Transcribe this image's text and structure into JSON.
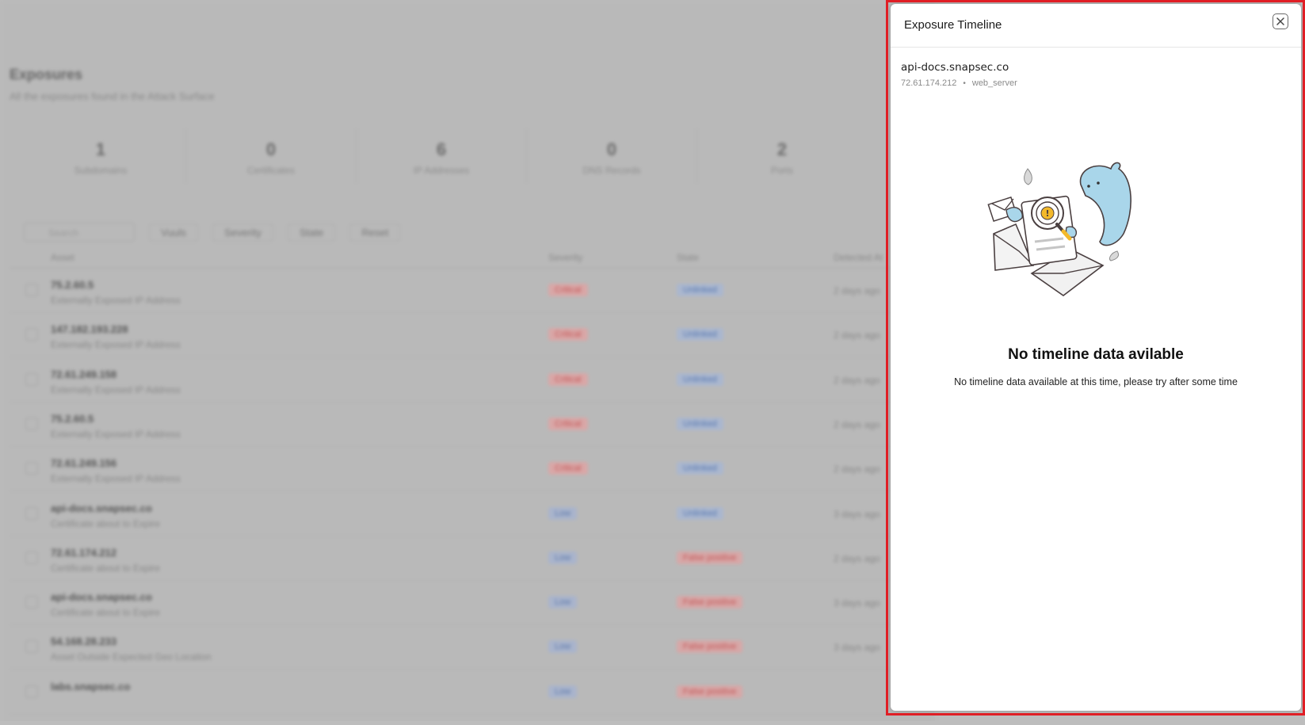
{
  "background": {
    "title": "Exposures",
    "subtitle": "All the exposures found in the Attack Surface",
    "stats": [
      {
        "value": "1",
        "label": "Subdomains"
      },
      {
        "value": "0",
        "label": "Certificates"
      },
      {
        "value": "6",
        "label": "IP Addresses"
      },
      {
        "value": "0",
        "label": "DNS Records"
      },
      {
        "value": "2",
        "label": "Ports"
      }
    ],
    "search_placeholder": "Search",
    "filters": [
      "Vuuls",
      "Severity",
      "State",
      "Reset"
    ],
    "columns": [
      "Asset",
      "Severity",
      "State",
      "Detected At"
    ],
    "rows": [
      {
        "name": "75.2.60.5",
        "desc": "Externally Exposed IP Address",
        "severity": "Critical",
        "state": "Unlinked",
        "date": "2 days ago"
      },
      {
        "name": "147.182.193.228",
        "desc": "Externally Exposed IP Address",
        "severity": "Critical",
        "state": "Unlinked",
        "date": "2 days ago"
      },
      {
        "name": "72.61.249.158",
        "desc": "Externally Exposed IP Address",
        "severity": "Critical",
        "state": "Unlinked",
        "date": "2 days ago"
      },
      {
        "name": "75.2.60.5",
        "desc": "Externally Exposed IP Address",
        "severity": "Critical",
        "state": "Unlinked",
        "date": "2 days ago"
      },
      {
        "name": "72.61.249.156",
        "desc": "Externally Exposed IP Address",
        "severity": "Critical",
        "state": "Unlinked",
        "date": "2 days ago"
      },
      {
        "name": "api-docs.snapsec.co",
        "desc": "Certificate about to Expire",
        "severity": "Low",
        "state": "Unlinked",
        "date": "3 days ago"
      },
      {
        "name": "72.61.174.212",
        "desc": "Certificate about to Expire",
        "severity": "Low",
        "state": "False positive",
        "date": "2 days ago"
      },
      {
        "name": "api-docs.snapsec.co",
        "desc": "Certificate about to Expire",
        "severity": "Low",
        "state": "False positive",
        "date": "3 days ago"
      },
      {
        "name": "54.168.28.233",
        "desc": "Asset Outside Expected Geo Location",
        "severity": "Low",
        "state": "False positive",
        "date": "3 days ago"
      },
      {
        "name": "labs.snapsec.co",
        "desc": "",
        "severity": "Low",
        "state": "False positive",
        "date": ""
      }
    ]
  },
  "panel": {
    "title": "Exposure Timeline",
    "close_icon": "close-icon",
    "asset_name": "api-docs.snapsec.co",
    "asset_ip": "72.61.174.212",
    "separator": "•",
    "asset_type": "web_server",
    "empty_title": "No timeline data avilable",
    "empty_description": "No timeline data available at this time, please try after some time",
    "illustration_icon": "empty-timeline-illustration"
  },
  "colors": {
    "highlight": "#e01e25",
    "overlay": "#bdbdbd",
    "illustration_blue": "#a9d6ea"
  }
}
